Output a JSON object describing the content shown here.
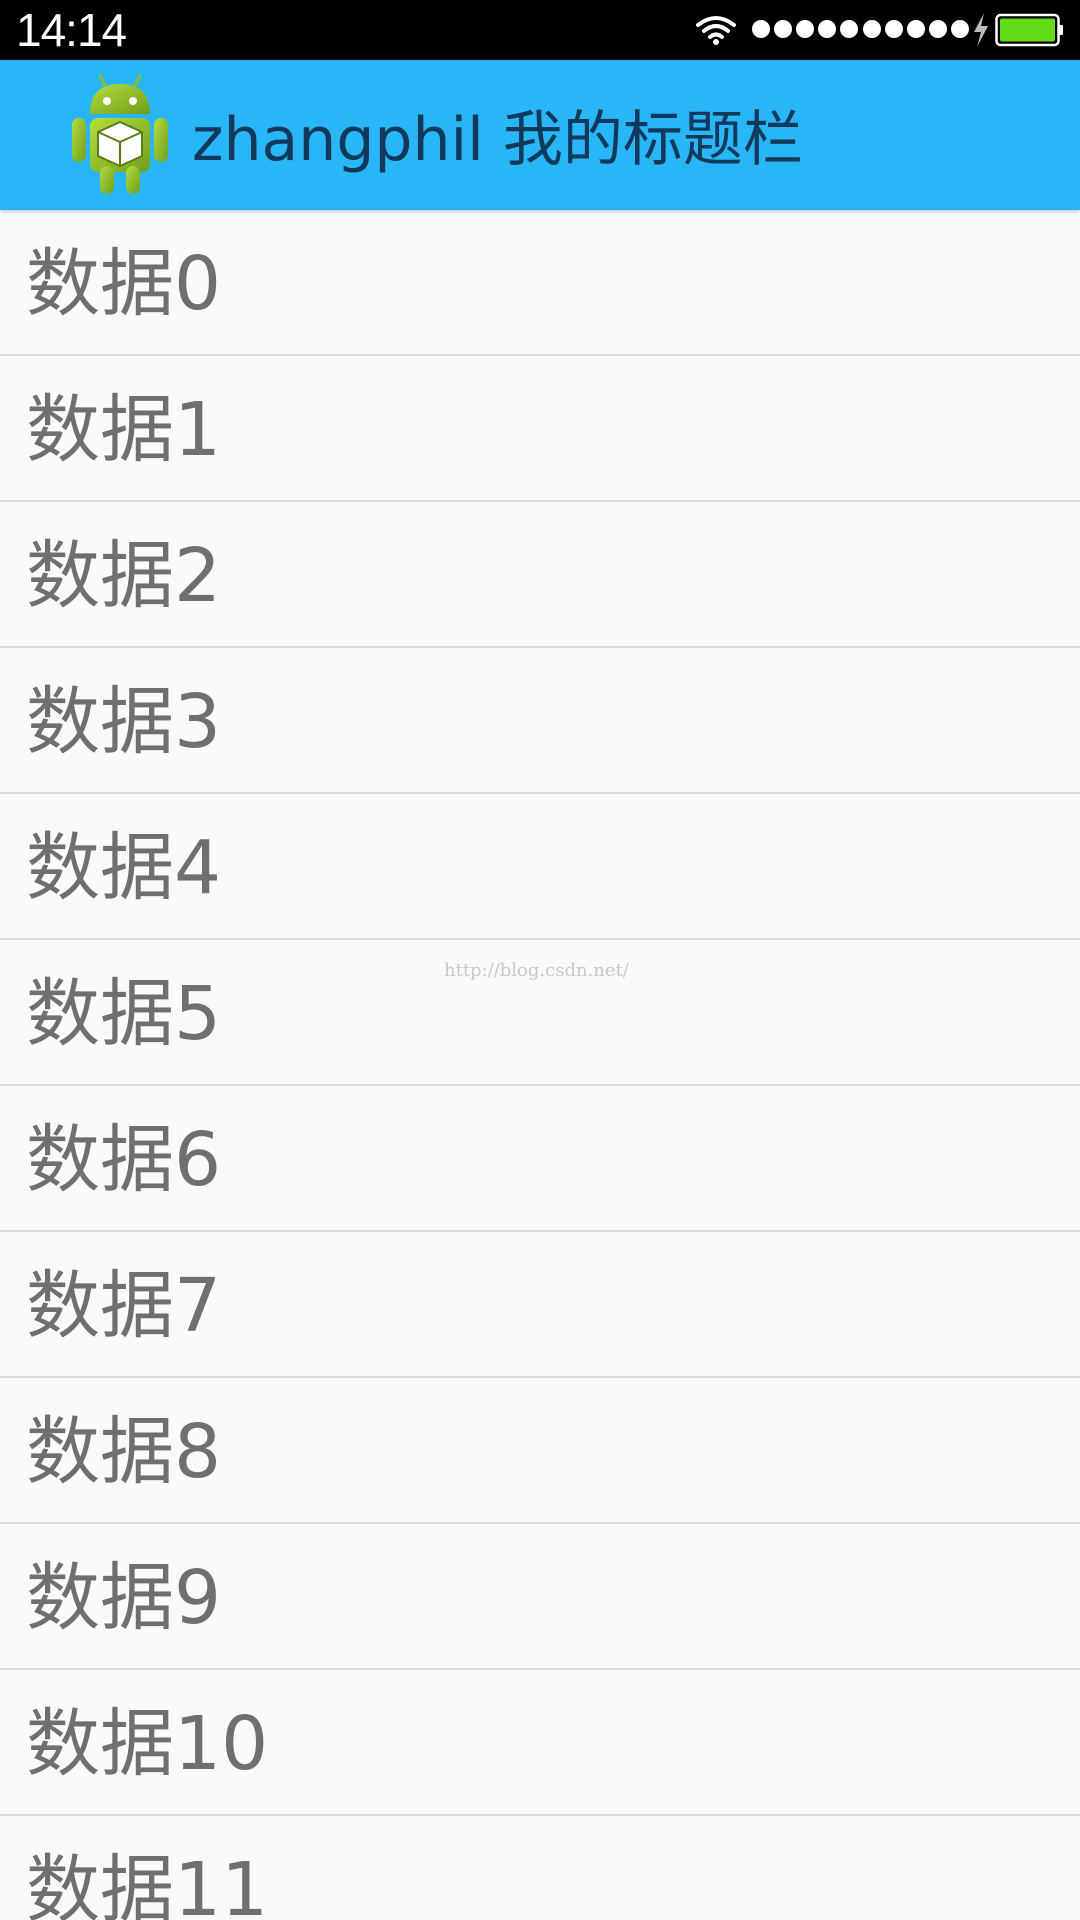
{
  "status_bar": {
    "time": "14:14",
    "wifi_icon": "wifi-icon",
    "signal_icon": "signal-dots-icon",
    "charging_icon": "bolt-icon",
    "battery_icon": "battery-icon",
    "battery_color": "#64dd17"
  },
  "app_bar": {
    "logo_icon": "android-logo-icon",
    "title": "zhangphil 我的标题栏",
    "background_color": "#29b6f6"
  },
  "list": {
    "items": [
      {
        "label": "数据0"
      },
      {
        "label": "数据1"
      },
      {
        "label": "数据2"
      },
      {
        "label": "数据3"
      },
      {
        "label": "数据4"
      },
      {
        "label": "数据5"
      },
      {
        "label": "数据6"
      },
      {
        "label": "数据7"
      },
      {
        "label": "数据8"
      },
      {
        "label": "数据9"
      },
      {
        "label": "数据10"
      },
      {
        "label": "数据11"
      }
    ]
  },
  "watermark": "http://blog.csdn.net/"
}
